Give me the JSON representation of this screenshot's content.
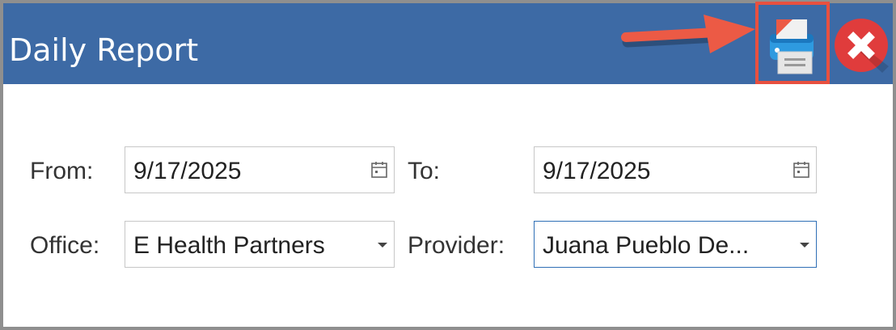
{
  "window": {
    "title": "Daily Report",
    "print_icon": "print-icon",
    "close_icon": "close-icon",
    "accent_color": "#3d6aa5",
    "highlight_color": "#e8503f"
  },
  "form": {
    "from_label": "From:",
    "from_value": "9/17/2025",
    "to_label": "To:",
    "to_value": "9/17/2025",
    "office_label": "Office:",
    "office_value": "E Health Partners",
    "provider_label": "Provider:",
    "provider_value": "Juana Pueblo De..."
  }
}
